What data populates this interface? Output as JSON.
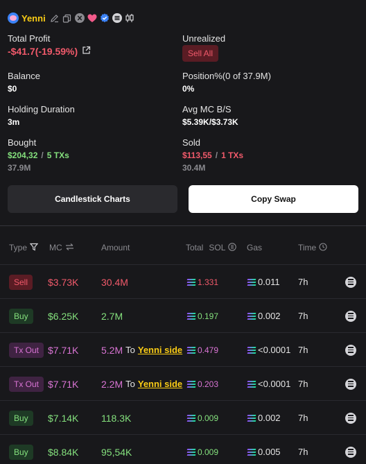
{
  "header": {
    "name": "Yenni",
    "icons": [
      "avatar",
      "edit-icon",
      "copy-icon",
      "x-icon",
      "heart-icon",
      "verified-icon",
      "list-icon",
      "candle-icon"
    ]
  },
  "stats": {
    "total_profit_label": "Total Profit",
    "total_profit_value": "-$41.7(-19.59%)",
    "unrealized_label": "Unrealized",
    "sell_all_label": "Sell All",
    "balance_label": "Balance",
    "balance_value": "$0",
    "position_label": "Position%(0 of 37.9M)",
    "position_value": "0%",
    "holding_label": "Holding Duration",
    "holding_value": "3m",
    "avg_mc_label": "Avg MC B/S",
    "avg_mc_value": "$5.39K/$3.73K",
    "bought_label": "Bought",
    "bought_amount": "$204,32",
    "bought_sep": "/",
    "bought_txs": "5 TXs",
    "bought_sub": "37.9M",
    "sold_label": "Sold",
    "sold_amount": "$113,55",
    "sold_sep": "/",
    "sold_txs": "1 TXs",
    "sold_sub": "30.4M"
  },
  "buttons": {
    "candlestick": "Candlestick Charts",
    "copy_swap": "Copy Swap"
  },
  "table": {
    "headers": {
      "type": "Type",
      "mc": "MC",
      "amount": "Amount",
      "total": "Total",
      "sol": "SOL",
      "gas": "Gas",
      "time": "Time"
    },
    "rows": [
      {
        "type": "Sell",
        "kind": "sell",
        "mc": "$3.73K",
        "amount": "30.4M",
        "to": "",
        "to_name": "",
        "total": "1.331",
        "gas": "0.011",
        "time": "7h"
      },
      {
        "type": "Buy",
        "kind": "buy",
        "mc": "$6.25K",
        "amount": "2.7M",
        "to": "",
        "to_name": "",
        "total": "0.197",
        "gas": "0.002",
        "time": "7h"
      },
      {
        "type": "Tx Out",
        "kind": "out",
        "mc": "$7.71K",
        "amount": "5.2M",
        "to": "To",
        "to_name": "Yenni side",
        "total": "0.479",
        "gas": "<0.0001",
        "time": "7h"
      },
      {
        "type": "Tx Out",
        "kind": "out",
        "mc": "$7.71K",
        "amount": "2.2M",
        "to": "To",
        "to_name": "Yenni side",
        "total": "0.203",
        "gas": "<0.0001",
        "time": "7h"
      },
      {
        "type": "Buy",
        "kind": "buy",
        "mc": "$7.14K",
        "amount": "118.3K",
        "to": "",
        "to_name": "",
        "total": "0.009",
        "gas": "0.002",
        "time": "7h"
      },
      {
        "type": "Buy",
        "kind": "buy",
        "mc": "$8.84K",
        "amount": "95,54K",
        "to": "",
        "to_name": "",
        "total": "0.009",
        "gas": "0.005",
        "time": "7h"
      }
    ]
  },
  "colors": {
    "red": "#f25a6b",
    "green": "#84e07d",
    "purple": "#d974d4",
    "accent_name": "#facc15"
  }
}
